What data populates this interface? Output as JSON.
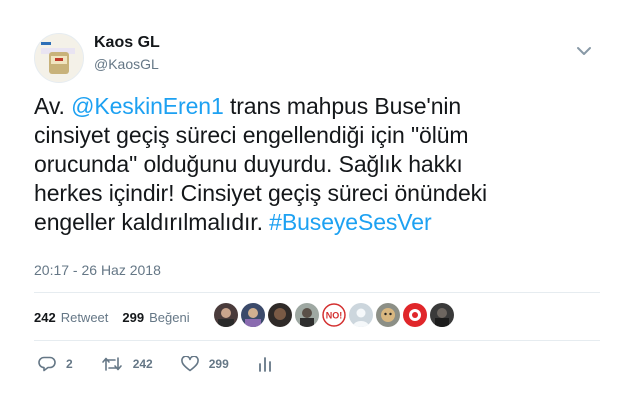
{
  "user": {
    "name": "Kaos GL",
    "handle": "@KaosGL"
  },
  "tweet": {
    "line1_a": "Av. ",
    "mention": "@KeskinEren1",
    "line1_b": " trans mahpus Buse'nin",
    "line2": "cinsiyet geçiş süreci engellendiği için \"ölüm",
    "line3": "orucunda\" olduğunu duyurdu. Sağlık hakkı",
    "line4": "herkes içindir! Cinsiyet geçiş süreci önündeki",
    "line5_a": "engeller kaldırılmalıdır. ",
    "hashtag": "#BuseyeSesVer",
    "timestamp": "20:17 - 26 Haz 2018"
  },
  "stats": {
    "retweets_count": "242",
    "retweets_label": "Retweet",
    "likes_count": "299",
    "likes_label": "Beğeni"
  },
  "actions": {
    "reply_count": "2",
    "retweet_count": "242",
    "like_count": "299"
  },
  "likers": [
    {
      "icon": "user-avatar"
    },
    {
      "icon": "user-avatar"
    },
    {
      "icon": "user-avatar"
    },
    {
      "icon": "user-avatar"
    },
    {
      "icon": "user-avatar",
      "text": "NO!"
    },
    {
      "icon": "default-avatar"
    },
    {
      "icon": "user-avatar"
    },
    {
      "icon": "user-avatar"
    },
    {
      "icon": "user-avatar"
    }
  ],
  "colors": {
    "link": "#1da1f2",
    "secondary": "#657786",
    "divider": "#e6ecf0"
  }
}
